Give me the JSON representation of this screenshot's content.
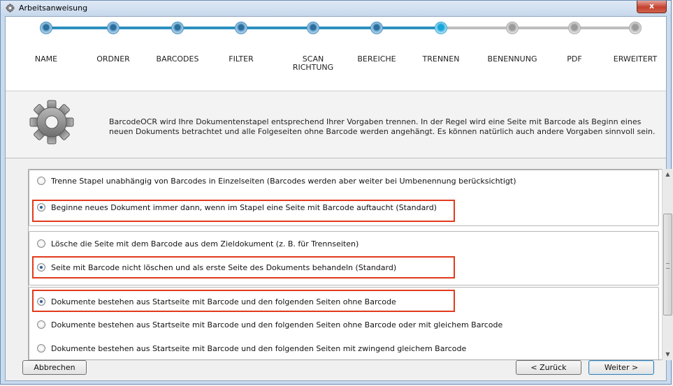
{
  "window": {
    "title": "Arbeitsanweisung",
    "close_label": "x",
    "icon": "gear-icon"
  },
  "wizard": {
    "steps": [
      {
        "label": "NAME",
        "state": "done"
      },
      {
        "label": "ORDNER",
        "state": "done"
      },
      {
        "label": "BARCODES",
        "state": "done"
      },
      {
        "label": "FILTER",
        "state": "done"
      },
      {
        "label_line1": "SCAN",
        "label_line2": "RICHTUNG",
        "state": "done"
      },
      {
        "label": "BEREICHE",
        "state": "done"
      },
      {
        "label": "TRENNEN",
        "state": "current"
      },
      {
        "label": "BENENNUNG",
        "state": "todo"
      },
      {
        "label": "PDF",
        "state": "todo"
      },
      {
        "label": "ERWEITERT",
        "state": "todo"
      }
    ],
    "colors": {
      "done": "#2c6f9c",
      "current": "#1aa5d8",
      "todo": "#b5b5b5"
    }
  },
  "info": {
    "icon": "gear-icon",
    "text": "BarcodeOCR wird Ihre Dokumentenstapel entsprechend Ihrer Vorgaben trennen. In der Regel wird eine Seite mit Barcode als Beginn eines neuen Dokuments betrachtet und alle Folgeseiten ohne Barcode werden angehängt. Es können natürlich auch andere Vorgaben sinnvoll sein."
  },
  "options": {
    "group1": [
      {
        "label": "Trenne Stapel unabhängig von Barcodes in Einzelseiten (Barcodes werden aber weiter bei Umbenennung berücksichtigt)",
        "checked": false
      },
      {
        "label": "Beginne neues Dokument immer dann, wenn im Stapel eine Seite mit Barcode auftaucht (Standard)",
        "checked": true
      }
    ],
    "group2": [
      {
        "label": "Lösche die Seite mit dem Barcode aus dem Zieldokument (z. B. für Trennseiten)",
        "checked": false
      },
      {
        "label": "Seite mit Barcode nicht löschen und als erste Seite des Dokuments behandeln (Standard)",
        "checked": true
      }
    ],
    "group3": [
      {
        "label": "Dokumente bestehen aus Startseite mit Barcode und den folgenden Seiten ohne Barcode",
        "checked": true
      },
      {
        "label": "Dokumente bestehen aus Startseite mit Barcode und den folgenden Seiten ohne Barcode oder mit gleichem Barcode",
        "checked": false
      },
      {
        "label": "Dokumente bestehen aus Startseite mit Barcode und den folgenden Seiten mit zwingend gleichem Barcode",
        "checked": false
      }
    ],
    "highlight_color": "#e23a1c"
  },
  "buttons": {
    "cancel": "Abbrechen",
    "back": "< Zurück",
    "next": "Weiter >"
  }
}
